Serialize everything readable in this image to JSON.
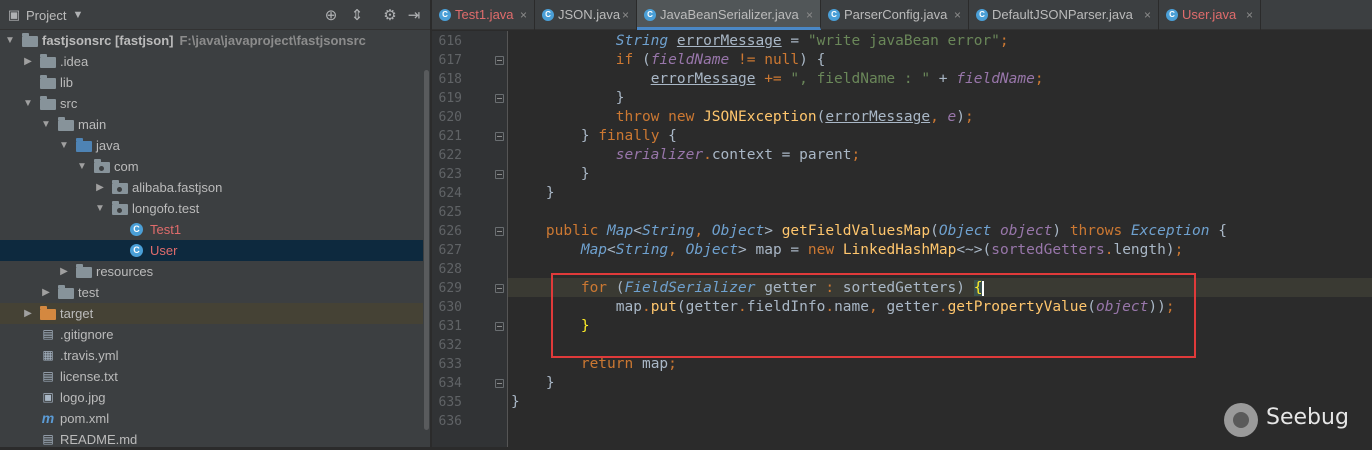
{
  "project_panel": {
    "title": "Project",
    "dropdown_icon": "chevron-down-icon",
    "toolbar_icons": [
      "crosshair-icon",
      "collapse-icon",
      "gear-icon",
      "hide-icon"
    ],
    "tree": [
      {
        "label": "fastjsonsrc [fastjson]",
        "path": "F:\\java\\javaproject\\fastjsonsrc",
        "icon": "module-folder-icon",
        "expanded": true
      },
      {
        "label": ".idea",
        "icon": "folder-icon",
        "expanded": false
      },
      {
        "label": "lib",
        "icon": "folder-icon",
        "expanded": null
      },
      {
        "label": "src",
        "icon": "folder-icon",
        "expanded": true
      },
      {
        "label": "main",
        "icon": "folder-icon",
        "expanded": true
      },
      {
        "label": "java",
        "icon": "source-folder-icon",
        "expanded": true
      },
      {
        "label": "com",
        "icon": "package-icon",
        "expanded": true
      },
      {
        "label": "alibaba.fastjson",
        "icon": "package-icon",
        "expanded": false
      },
      {
        "label": "longofo.test",
        "icon": "package-icon",
        "expanded": true
      },
      {
        "label": "Test1",
        "icon": "java-class-run-icon",
        "expanded": null
      },
      {
        "label": "User",
        "icon": "java-class-icon",
        "expanded": null
      },
      {
        "label": "resources",
        "icon": "resources-folder-icon",
        "expanded": false
      },
      {
        "label": "test",
        "icon": "folder-icon",
        "expanded": false
      },
      {
        "label": "target",
        "icon": "excluded-folder-icon",
        "expanded": false
      },
      {
        "label": ".gitignore",
        "icon": "text-file-icon",
        "expanded": null
      },
      {
        "label": ".travis.yml",
        "icon": "table-file-icon",
        "expanded": null
      },
      {
        "label": "license.txt",
        "icon": "text-file-icon",
        "expanded": null
      },
      {
        "label": "logo.jpg",
        "icon": "image-file-icon",
        "expanded": null
      },
      {
        "label": "pom.xml",
        "icon": "maven-icon",
        "expanded": null
      },
      {
        "label": "README.md",
        "icon": "markdown-file-icon",
        "expanded": null
      }
    ]
  },
  "tabs": [
    {
      "label": "Test1.java",
      "active": false,
      "modified": true
    },
    {
      "label": "JSON.java",
      "active": false,
      "modified": false
    },
    {
      "label": "JavaBeanSerializer.java",
      "active": true,
      "modified": false
    },
    {
      "label": "ParserConfig.java",
      "active": false,
      "modified": false
    },
    {
      "label": "DefaultJSONParser.java",
      "active": false,
      "modified": false
    },
    {
      "label": "User.java",
      "active": false,
      "modified": true
    }
  ],
  "editor": {
    "current_line": "629",
    "lines": [
      {
        "n": "616",
        "tokens": [
          [
            "ind",
            "            "
          ],
          [
            "typ",
            "String"
          ],
          [
            "plain",
            " "
          ],
          [
            "ul",
            "errorMessage"
          ],
          [
            "plain",
            " = "
          ],
          [
            "str",
            "\"write javaBean error\""
          ],
          [
            "kw",
            ";"
          ]
        ]
      },
      {
        "n": "617",
        "tokens": [
          [
            "ind",
            "            "
          ],
          [
            "kw",
            "if"
          ],
          [
            "plain",
            " ("
          ],
          [
            "var",
            "fieldName"
          ],
          [
            "plain",
            " "
          ],
          [
            "kw",
            "!="
          ],
          [
            "plain",
            " "
          ],
          [
            "kw",
            "null"
          ],
          [
            "plain",
            ") {"
          ]
        ]
      },
      {
        "n": "618",
        "tokens": [
          [
            "ind",
            "                "
          ],
          [
            "ul",
            "errorMessage"
          ],
          [
            "plain",
            " "
          ],
          [
            "kw",
            "+="
          ],
          [
            "plain",
            " "
          ],
          [
            "str",
            "\", fieldName : \""
          ],
          [
            "plain",
            " + "
          ],
          [
            "var",
            "fieldName"
          ],
          [
            "kw",
            ";"
          ]
        ]
      },
      {
        "n": "619",
        "tokens": [
          [
            "ind",
            "            "
          ],
          [
            "plain",
            "}"
          ]
        ]
      },
      {
        "n": "620",
        "tokens": [
          [
            "ind",
            "            "
          ],
          [
            "kw",
            "throw new"
          ],
          [
            "plain",
            " "
          ],
          [
            "fn2",
            "JSONException"
          ],
          [
            "plain",
            "("
          ],
          [
            "ul",
            "errorMessage"
          ],
          [
            "kw",
            ","
          ],
          [
            "plain",
            " "
          ],
          [
            "var",
            "e"
          ],
          [
            "plain",
            ")"
          ],
          [
            "kw",
            ";"
          ]
        ]
      },
      {
        "n": "621",
        "tokens": [
          [
            "ind",
            "        "
          ],
          [
            "plain",
            "} "
          ],
          [
            "kw",
            "finally"
          ],
          [
            "plain",
            " {"
          ]
        ]
      },
      {
        "n": "622",
        "tokens": [
          [
            "ind",
            "            "
          ],
          [
            "var",
            "serializer"
          ],
          [
            "kw",
            "."
          ],
          [
            "plain",
            "context = parent"
          ],
          [
            "kw",
            ";"
          ]
        ]
      },
      {
        "n": "623",
        "tokens": [
          [
            "ind",
            "        "
          ],
          [
            "plain",
            "}"
          ]
        ]
      },
      {
        "n": "624",
        "tokens": [
          [
            "ind",
            "    "
          ],
          [
            "plain",
            "}"
          ]
        ]
      },
      {
        "n": "625",
        "tokens": []
      },
      {
        "n": "626",
        "tokens": [
          [
            "ind",
            "    "
          ],
          [
            "kw",
            "public"
          ],
          [
            "plain",
            " "
          ],
          [
            "typ",
            "Map"
          ],
          [
            "plain",
            "<"
          ],
          [
            "typ",
            "String"
          ],
          [
            "kw",
            ","
          ],
          [
            "plain",
            " "
          ],
          [
            "typ",
            "Object"
          ],
          [
            "plain",
            "> "
          ],
          [
            "fn2",
            "getFieldValuesMap"
          ],
          [
            "plain",
            "("
          ],
          [
            "typ",
            "Object"
          ],
          [
            "plain",
            " "
          ],
          [
            "var",
            "object"
          ],
          [
            "plain",
            ") "
          ],
          [
            "kw",
            "throws"
          ],
          [
            "plain",
            " "
          ],
          [
            "typ",
            "Exception"
          ],
          [
            "plain",
            " {"
          ]
        ]
      },
      {
        "n": "627",
        "tokens": [
          [
            "ind",
            "        "
          ],
          [
            "typ",
            "Map"
          ],
          [
            "plain",
            "<"
          ],
          [
            "typ",
            "String"
          ],
          [
            "kw",
            ","
          ],
          [
            "plain",
            " "
          ],
          [
            "typ",
            "Object"
          ],
          [
            "plain",
            "> map = "
          ],
          [
            "kw",
            "new"
          ],
          [
            "plain",
            " "
          ],
          [
            "fn2",
            "LinkedHashMap"
          ],
          [
            "plain",
            "<~>("
          ],
          [
            "fld",
            "sortedGetters"
          ],
          [
            "kw",
            "."
          ],
          [
            "plain",
            "length)"
          ],
          [
            "kw",
            ";"
          ]
        ]
      },
      {
        "n": "628",
        "tokens": []
      },
      {
        "n": "629",
        "tokens": [
          [
            "ind",
            "        "
          ],
          [
            "kw",
            "for"
          ],
          [
            "plain",
            " ("
          ],
          [
            "typ",
            "FieldSerializer"
          ],
          [
            "plain",
            " getter "
          ],
          [
            "kw",
            ":"
          ],
          [
            "plain",
            " sortedGetters) "
          ],
          [
            "brace",
            "{"
          ],
          [
            "cursor",
            ""
          ]
        ]
      },
      {
        "n": "630",
        "tokens": [
          [
            "ind",
            "            "
          ],
          [
            "plain",
            "map"
          ],
          [
            "kw",
            "."
          ],
          [
            "fn2",
            "put"
          ],
          [
            "plain",
            "(getter"
          ],
          [
            "kw",
            "."
          ],
          [
            "plain",
            "fieldInfo"
          ],
          [
            "kw",
            "."
          ],
          [
            "plain",
            "name"
          ],
          [
            "kw",
            ","
          ],
          [
            "plain",
            " getter"
          ],
          [
            "kw",
            "."
          ],
          [
            "fn2",
            "getPropertyValue"
          ],
          [
            "plain",
            "("
          ],
          [
            "var",
            "object"
          ],
          [
            "plain",
            "))"
          ],
          [
            "kw",
            ";"
          ]
        ]
      },
      {
        "n": "631",
        "tokens": [
          [
            "ind",
            "        "
          ],
          [
            "brace2",
            "}"
          ]
        ]
      },
      {
        "n": "632",
        "tokens": []
      },
      {
        "n": "633",
        "tokens": [
          [
            "ind",
            "        "
          ],
          [
            "kw",
            "return"
          ],
          [
            "plain",
            " map"
          ],
          [
            "kw",
            ";"
          ]
        ]
      },
      {
        "n": "634",
        "tokens": [
          [
            "ind",
            "    "
          ],
          [
            "plain",
            "}"
          ]
        ]
      },
      {
        "n": "635",
        "tokens": [
          [
            "plain",
            "}"
          ]
        ]
      },
      {
        "n": "636",
        "tokens": []
      }
    ]
  },
  "watermark": {
    "text": "Seebug"
  },
  "colors": {
    "highlight_box": "#e03a3a",
    "active_tab_underline": "#4a88c7",
    "selection": "#0d293e"
  }
}
